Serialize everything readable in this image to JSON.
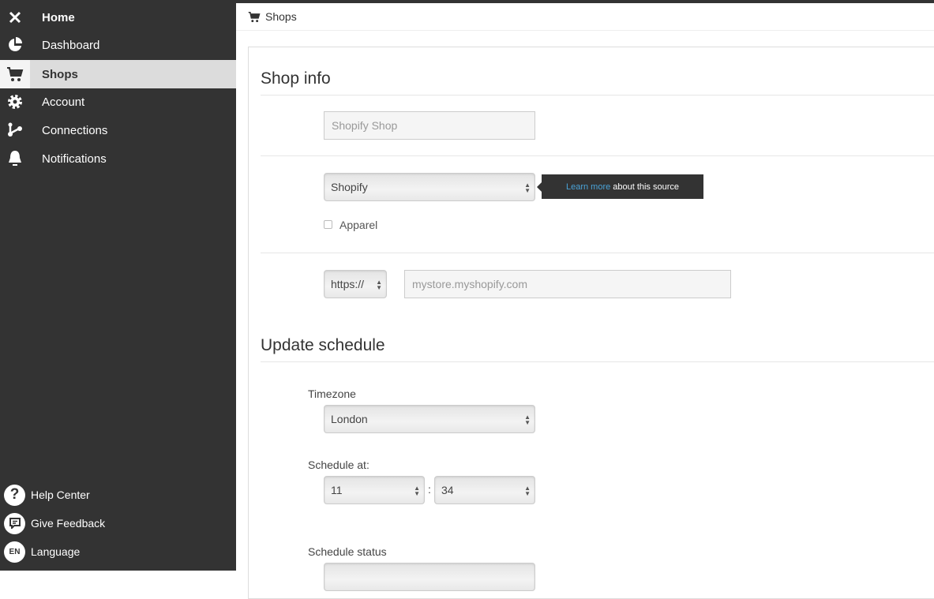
{
  "sidebar": {
    "items": [
      {
        "label": "Home",
        "icon": "close-icon"
      },
      {
        "label": "Dashboard",
        "icon": "pie-chart-icon"
      },
      {
        "label": "Shops",
        "icon": "cart-icon",
        "active": true
      },
      {
        "label": "Account",
        "icon": "gear-icon"
      },
      {
        "label": "Connections",
        "icon": "branch-icon"
      },
      {
        "label": "Notifications",
        "icon": "bell-icon"
      }
    ],
    "bottom": [
      {
        "label": "Help Center",
        "icon": "question-icon",
        "glyph": "?"
      },
      {
        "label": "Give Feedback",
        "icon": "feedback-icon"
      },
      {
        "label": "Language",
        "icon": "language-icon",
        "glyph": "EN"
      }
    ]
  },
  "header": {
    "title": "Shops"
  },
  "shop_info": {
    "heading": "Shop info",
    "name_placeholder": "Shopify Shop",
    "source_select": "Shopify",
    "tooltip_link": "Learn more",
    "tooltip_text": "about this source",
    "apparel_label": "Apparel",
    "apparel_checked": false,
    "protocol_select": "https://",
    "url_placeholder": "mystore.myshopify.com"
  },
  "update_schedule": {
    "heading": "Update schedule",
    "timezone_label": "Timezone",
    "timezone_value": "London",
    "schedule_at_label": "Schedule at:",
    "hour_value": "11",
    "separator": ":",
    "minute_value": "34",
    "status_label": "Schedule status"
  }
}
